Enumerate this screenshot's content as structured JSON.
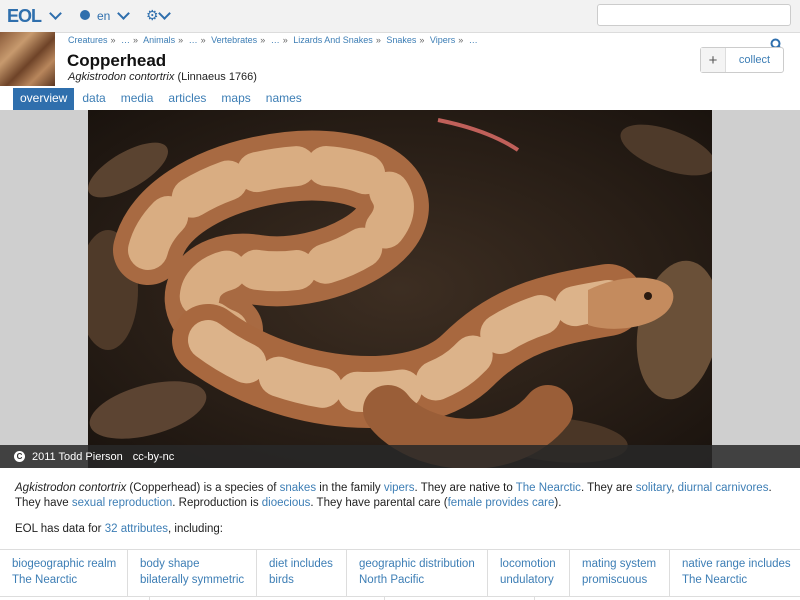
{
  "topbar": {
    "logo": "EOL",
    "language": "en",
    "search_placeholder": ""
  },
  "header": {
    "breadcrumb": [
      "Creatures",
      "…",
      "Animals",
      "…",
      "Vertebrates",
      "…",
      "Lizards And Snakes",
      "Snakes",
      "Vipers",
      "…"
    ],
    "title": "Copperhead",
    "scientific_name": "Agkistrodon contortrix",
    "authority": "(Linnaeus 1766)",
    "collect_label": "collect",
    "collect_plus": "+"
  },
  "tabs": [
    {
      "label": "overview",
      "active": true
    },
    {
      "label": "data",
      "active": false
    },
    {
      "label": "media",
      "active": false
    },
    {
      "label": "articles",
      "active": false
    },
    {
      "label": "maps",
      "active": false
    },
    {
      "label": "names",
      "active": false
    }
  ],
  "hero": {
    "copyright_symbol": "C",
    "credit": "2011 Todd Pierson",
    "license": "cc-by-nc"
  },
  "summary": {
    "p1_sci": "Agkistrodon contortrix",
    "p1_a": " (Copperhead) is a species of ",
    "link_snakes": "snakes",
    "p1_b": " in the family ",
    "link_vipers": "vipers",
    "p1_c": ". They are native to ",
    "link_nearctic": "The Nearctic",
    "p1_d": ". They are ",
    "link_solitary": "solitary",
    "p1_e": ", ",
    "link_diurnal": "diurnal",
    "p1_f": " ",
    "link_carnivores": "carnivores",
    "p1_g": ". They have ",
    "link_sexual": "sexual reproduction",
    "p1_h": ". Reproduction is ",
    "link_dioecious": "dioecious",
    "p1_i": ". They have parental care (",
    "link_female": "female provides care",
    "p1_j": ")."
  },
  "attributes_intro": {
    "prefix": "EOL has data for ",
    "link": "32 attributes",
    "suffix": ", including:"
  },
  "attributes": [
    {
      "label": "biogeographic realm",
      "value": "The Nearctic"
    },
    {
      "label": "body shape",
      "value": "bilaterally symmetric"
    },
    {
      "label": "diet includes",
      "value": "birds"
    },
    {
      "label": "geographic distribution",
      "value": "North Pacific"
    },
    {
      "label": "locomotion",
      "value": "undulatory"
    },
    {
      "label": "mating system",
      "value": "promiscuous"
    },
    {
      "label": "native range includes",
      "value": "The Nearctic"
    }
  ],
  "colors": {
    "accent": "#2f6fad",
    "link": "#3d7eb5"
  }
}
